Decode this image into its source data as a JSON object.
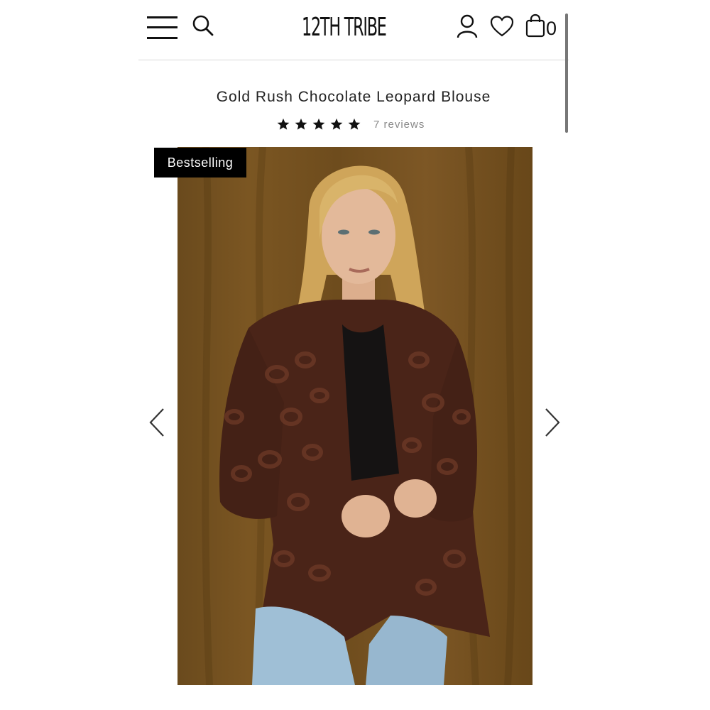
{
  "header": {
    "logo_text": "12TH TRIBE",
    "cart_count": "0",
    "icons": [
      "menu-icon",
      "search-icon",
      "account-icon",
      "heart-icon",
      "bag-icon"
    ]
  },
  "product": {
    "title": "Gold Rush Chocolate Leopard Blouse",
    "rating_stars": 5,
    "reviews_label": "7 reviews",
    "badge": "Bestselling"
  },
  "gallery": {
    "prev_icon": "chevron-left-icon",
    "next_icon": "chevron-right-icon"
  },
  "colors": {
    "backdrop": "#7a5422",
    "blouse": "#4a2418",
    "denim": "#9fbfd6",
    "hair": "#d9b46a",
    "skin": "#e3b99a"
  }
}
